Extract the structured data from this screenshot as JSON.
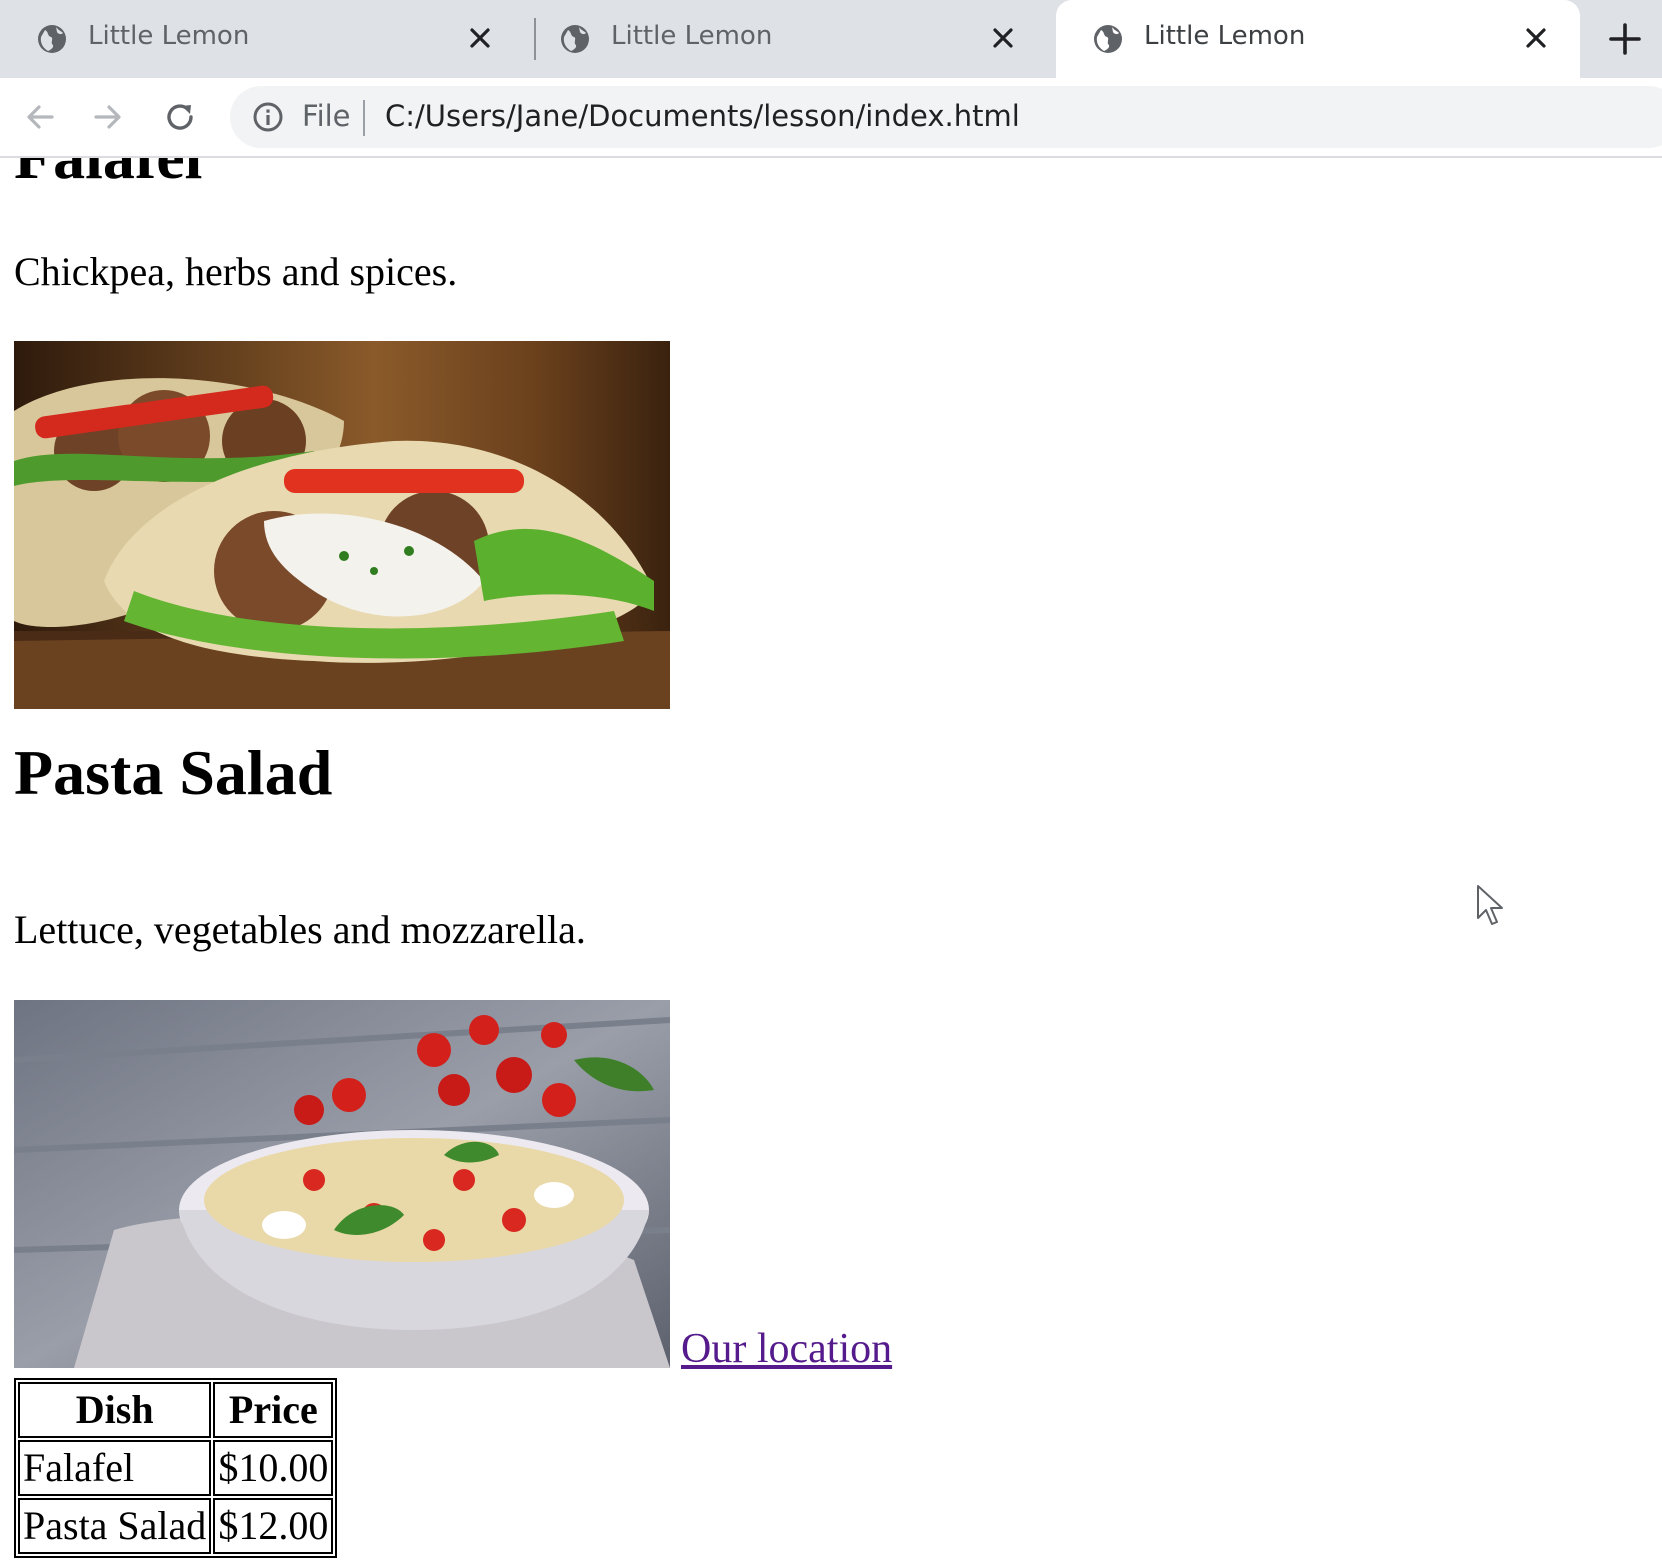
{
  "browser": {
    "tabs": [
      {
        "title": "Little Lemon",
        "active": false
      },
      {
        "title": "Little Lemon",
        "active": false
      },
      {
        "title": "Little Lemon",
        "active": true
      }
    ],
    "new_tab_icon": "plus-icon",
    "address_bar": {
      "security_label": "File",
      "url": "C:/Users/Jane/Documents/lesson/index.html"
    },
    "nav_icons": [
      "arrow-left-icon",
      "arrow-right-icon",
      "reload-icon"
    ]
  },
  "page": {
    "partial_heading": "Falafel",
    "falafel_description": "Chickpea, herbs and spices.",
    "falafel_image": "falafel-pita-photo",
    "pasta_heading": "Pasta Salad",
    "pasta_description": "Lettuce, vegetables and mozzarella.",
    "pasta_image": "pasta-salad-bowl-photo",
    "location_link": "Our location",
    "menu_table": {
      "headers": [
        "Dish",
        "Price"
      ],
      "rows": [
        [
          "Falafel",
          "$10.00"
        ],
        [
          "Pasta Salad",
          "$12.00"
        ]
      ]
    }
  },
  "colors": {
    "tabstrip": "#dee1e6",
    "visited_link": "#551a8b",
    "omnibox": "#f1f3f4"
  }
}
